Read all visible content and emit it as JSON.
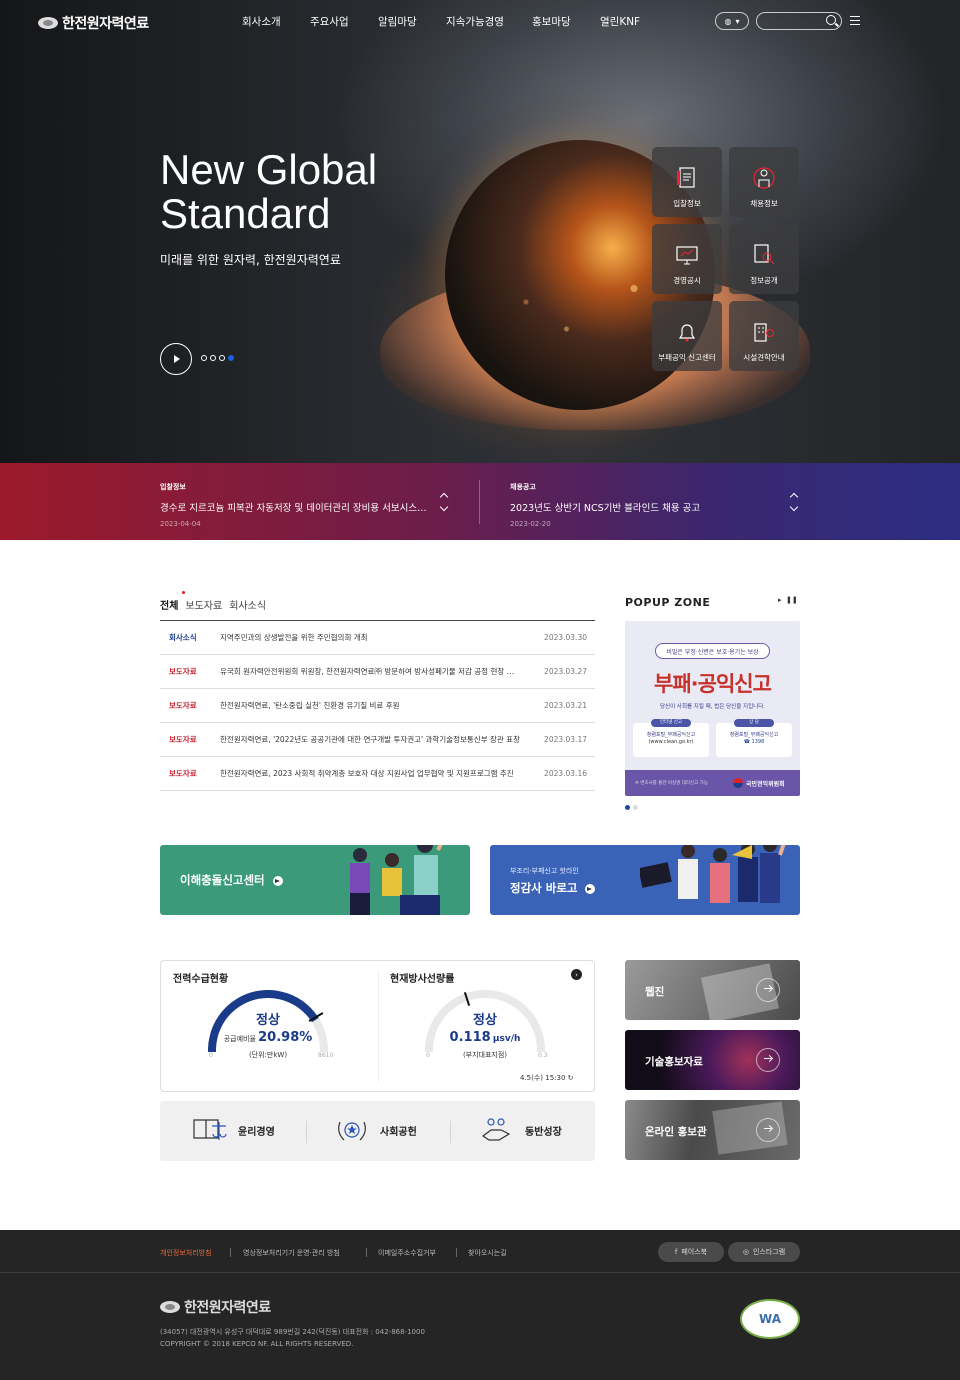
{
  "header": {
    "logo_text": "한전원자력연료",
    "nav": [
      "회사소개",
      "주요사업",
      "알림마당",
      "지속가능경영",
      "홍보마당",
      "열린KNF"
    ],
    "lang_icon": "globe-icon",
    "search_placeholder": ""
  },
  "hero": {
    "title": "New Global Standard",
    "subtitle": "미래를 위한 원자력, 한전원자력연료",
    "slide_count": 4,
    "active_slide": 4
  },
  "quick_links": [
    {
      "label": "입찰정보",
      "icon": "document-icon"
    },
    {
      "label": "채용정보",
      "icon": "person-icon"
    },
    {
      "label": "경영공시",
      "icon": "monitor-icon"
    },
    {
      "label": "정보공개",
      "icon": "file-search-icon"
    },
    {
      "label": "부패공익 신고센터",
      "icon": "bell-icon"
    },
    {
      "label": "시설견학안내",
      "icon": "building-location-icon"
    }
  ],
  "notice_band": [
    {
      "category": "입찰정보",
      "title": "경수로 지르코늄 피복관 자동저장 및 데이터관리 장비용 서보시스템...",
      "date": "2023-04-04"
    },
    {
      "category": "채용공고",
      "title": "2023년도 상반기 NCS기반 블라인드 채용 공고",
      "date": "2023-02-20"
    }
  ],
  "news": {
    "tabs": [
      "전체",
      "보도자료",
      "회사소식"
    ],
    "items": [
      {
        "category": "회사소식",
        "color": "#1d3f8f",
        "title": "지역주민과의 상생발전을 위한 주민협의회 개최",
        "date": "2023.03.30"
      },
      {
        "category": "보도자료",
        "color": "#c8202f",
        "title": "유국희 원자력안전위원회 위원장, 한전원자력연료㈜ 방문하여 방사성폐기물 저감 공정 현장 점검",
        "date": "2023.03.27"
      },
      {
        "category": "보도자료",
        "color": "#c8202f",
        "title": "한전원자력연료, '탄소중립 실천' 친환경 유기질 비료 후원",
        "date": "2023.03.21"
      },
      {
        "category": "보도자료",
        "color": "#c8202f",
        "title": "한전원자력연료, '2022년도 공공기관에 대한 연구개발 투자권고' 과학기술정보통신부 장관 표창",
        "date": "2023.03.17"
      },
      {
        "category": "보도자료",
        "color": "#c8202f",
        "title": "한전원자력연료, 2023 사회적 취약계층 보호자 대상 지원사업 업무협약 및 지원프로그램 추진",
        "date": "2023.03.16"
      }
    ]
  },
  "popup": {
    "heading": "POPUP ZONE",
    "tagline": "비밀은 부정·신변은 보호·용기는 보상",
    "big": "부패·공익신고",
    "sub": "당신이 사회를 지킬 때, 법은 당신을 지킵니다.",
    "box1_title": "인터넷 신고",
    "box1_text": "청렴포털_부패공익신고",
    "box1_url": "(www.clean.go.kr)",
    "box2_title": "상 담",
    "box2_text": "청렴포털_부패공익신고",
    "box2_phone": "☎ 1398",
    "footer_note": "※ 변호사를 통한 비실명 대리신고 가능",
    "org": "국민권익위원회",
    "slides": 2,
    "active": 1
  },
  "banners": {
    "left": {
      "label": "이해충돌신고센터",
      "color": "#3a9a7a"
    },
    "right": {
      "small": "부조리·부패신고 핫라인",
      "label": "정감사 바로고",
      "color": "#3a63b8"
    }
  },
  "gauges": {
    "power": {
      "title": "전력수급현황",
      "status": "정상",
      "prefix": "공급예비율",
      "value": "20.98%",
      "unit": "(단위:만kW)",
      "min": "0",
      "max": "8610",
      "fraction": 0.82
    },
    "radiation": {
      "title": "현재방사선량률",
      "status": "정상",
      "value": "0.118",
      "value_unit": "μsv/h",
      "unit": "(부지대표지점)",
      "min": "0",
      "max": "0.3",
      "fraction": 0.39
    },
    "timestamp": "4.5(수) 15:30"
  },
  "values": [
    {
      "label": "윤리경영",
      "icon": "scale-book-icon"
    },
    {
      "label": "사회공헌",
      "icon": "laurel-star-icon"
    },
    {
      "label": "동반성장",
      "icon": "handshake-icon"
    }
  ],
  "side_links": [
    {
      "label": "웹진",
      "color": "#8a8a8a"
    },
    {
      "label": "기술홍보자료",
      "color": "#1a1020"
    },
    {
      "label": "온라인 홍보관",
      "color": "#5a5a5a"
    }
  ],
  "footer": {
    "links": [
      "개인정보처리방침",
      "영상정보처리기기 운영·관리 방침",
      "이메일주소수집거부",
      "찾아오시는길"
    ],
    "sns": [
      {
        "label": "페이스북",
        "icon": "facebook-icon"
      },
      {
        "label": "인스타그램",
        "icon": "instagram-icon"
      }
    ],
    "logo_text": "한전원자력연료",
    "address": "(34057) 대전광역시 유성구 대덕대로 989번길 242(덕진동) 대표전화 : 042-868-1000",
    "copyright": "COPYRIGHT © 2018 KEPCO NF. ALL RIGHTS RESERVED.",
    "wa_mark": "WA",
    "wa_caption": "과학기술정보통신부 WEB ACCESSIBILITY"
  }
}
